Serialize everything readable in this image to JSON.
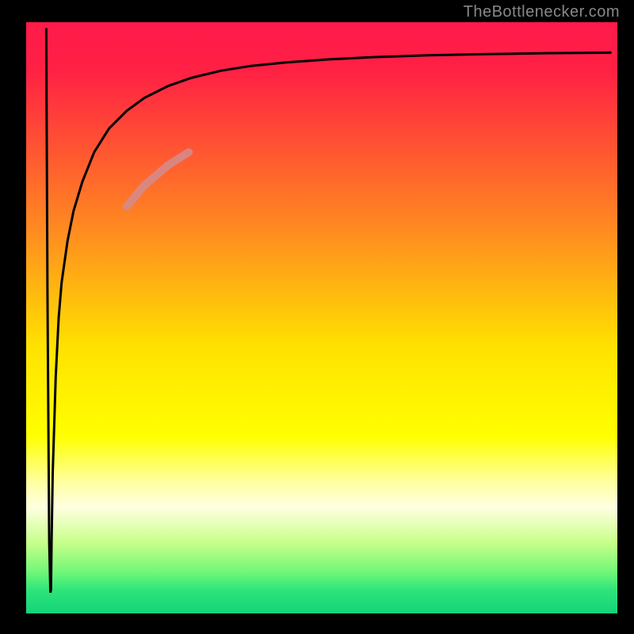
{
  "attribution": "TheBottlenecker.com",
  "chart_data": {
    "type": "line",
    "title": "",
    "xlabel": "",
    "ylabel": "",
    "xlim": [
      0,
      100
    ],
    "ylim": [
      0,
      100
    ],
    "background_gradient": {
      "stops": [
        {
          "offset": 0.0,
          "color": "#ff1a4b"
        },
        {
          "offset": 0.08,
          "color": "#ff2044"
        },
        {
          "offset": 0.35,
          "color": "#ff8a20"
        },
        {
          "offset": 0.55,
          "color": "#ffe200"
        },
        {
          "offset": 0.7,
          "color": "#ffff00"
        },
        {
          "offset": 0.78,
          "color": "#ffffa5"
        },
        {
          "offset": 0.82,
          "color": "#ffffe0"
        },
        {
          "offset": 0.88,
          "color": "#c8ff8a"
        },
        {
          "offset": 0.93,
          "color": "#70f778"
        },
        {
          "offset": 0.96,
          "color": "#2fe57a"
        },
        {
          "offset": 1.0,
          "color": "#14d37a"
        }
      ]
    },
    "series": [
      {
        "name": "bottleneck-curve",
        "color": "#000000",
        "width": 3,
        "x": [
          3.4,
          3.6,
          3.9,
          4.1,
          4.2,
          4.3,
          4.5,
          5.0,
          5.5,
          6.0,
          7.0,
          8.0,
          9.5,
          11.5,
          14.0,
          17.0,
          20.0,
          24.0,
          28.0,
          33.0,
          38.0,
          44.0,
          51.0,
          59.0,
          68.0,
          78.0,
          88.0,
          99.0
        ],
        "y": [
          99.0,
          55.0,
          12.0,
          3.5,
          4.0,
          12.0,
          24.0,
          40.0,
          50.0,
          56.0,
          63.0,
          68.0,
          73.0,
          78.0,
          82.0,
          85.0,
          87.2,
          89.2,
          90.6,
          91.8,
          92.6,
          93.2,
          93.7,
          94.1,
          94.4,
          94.6,
          94.75,
          94.85
        ]
      },
      {
        "name": "highlight-segment",
        "color": "#d68a8a",
        "width": 10,
        "opacity": 0.9,
        "x": [
          17.0,
          20.0,
          24.0,
          27.5
        ],
        "y": [
          68.8,
          72.4,
          75.8,
          78.0
        ]
      }
    ]
  }
}
